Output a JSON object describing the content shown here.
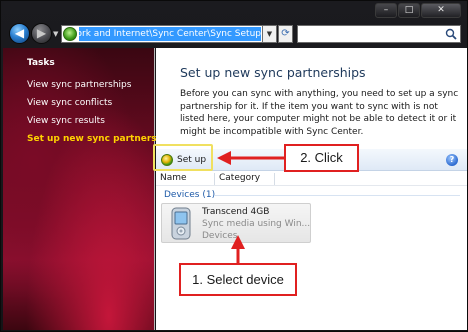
{
  "caption": {
    "minimize": "–",
    "maximize": "□",
    "close": "✕"
  },
  "nav": {
    "back_glyph": "◀",
    "forward_glyph": "▶",
    "address_path": "« Network and Internet ▸ Sync Center ▸ Sync Setup",
    "address_visible": "work and Internet\\Sync Center\\Sync Setup",
    "dropdown_glyph": "▼",
    "refresh_glyph": "⟳",
    "search_placeholder": ""
  },
  "sidebar": {
    "title": "Tasks",
    "items": [
      {
        "label": "View sync partnerships"
      },
      {
        "label": "View sync conflicts"
      },
      {
        "label": "View sync results"
      },
      {
        "label": "Set up new sync partnerships",
        "active": true
      }
    ]
  },
  "main": {
    "title": "Set up new sync partnerships",
    "description": "Before you can sync with anything, you need to set up a sync partnership for it. If the item you want to sync with is not listed here, your computer might not be able to detect it or it might be incompatible with Sync Center.",
    "toolbar": {
      "setup_label": "Set up",
      "help_glyph": "?"
    },
    "columns": [
      "Name",
      "Category"
    ],
    "group": {
      "label": "Devices (1)"
    },
    "device": {
      "name": "Transcend 4GB",
      "description": "Sync media using Win...",
      "category": "Devices"
    }
  },
  "annotations": {
    "step1": "1. Select device",
    "step2": "2. Click"
  },
  "colors": {
    "accent_red": "#e02020",
    "highlight_yellow": "#f0e060",
    "active_task": "#ffd200",
    "address_selection": "#3399ff"
  }
}
